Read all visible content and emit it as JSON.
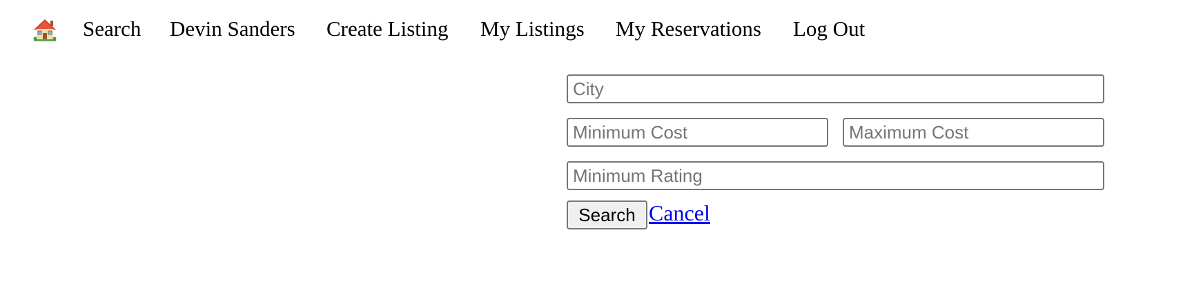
{
  "nav": {
    "home_icon": "house-icon",
    "items": [
      {
        "label": "Search"
      },
      {
        "label": "Devin Sanders"
      },
      {
        "label": "Create Listing"
      },
      {
        "label": "My Listings"
      },
      {
        "label": "My Reservations"
      },
      {
        "label": "Log Out"
      }
    ]
  },
  "search_form": {
    "city": {
      "placeholder": "City",
      "value": ""
    },
    "min_cost": {
      "placeholder": "Minimum Cost",
      "value": ""
    },
    "max_cost": {
      "placeholder": "Maximum Cost",
      "value": ""
    },
    "min_rating": {
      "placeholder": "Minimum Rating",
      "value": ""
    },
    "submit_label": "Search",
    "cancel_label": "Cancel"
  },
  "colors": {
    "link": "#0000ee",
    "input_border": "#767676",
    "button_bg": "#efefef",
    "placeholder": "#757575"
  }
}
